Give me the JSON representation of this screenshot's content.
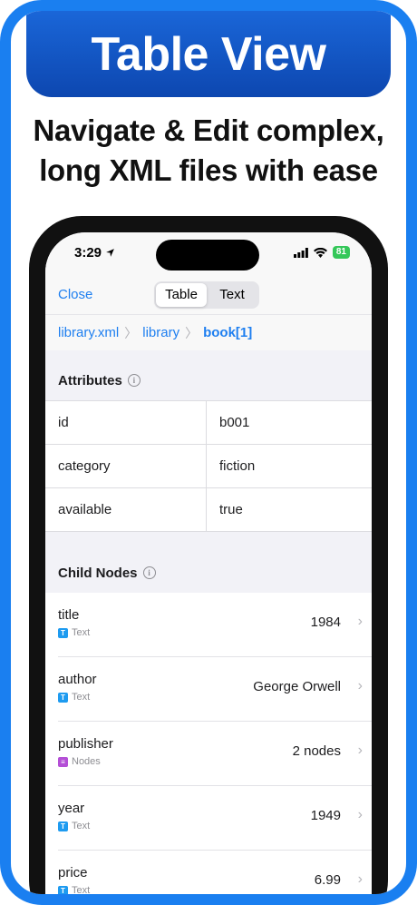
{
  "promo": {
    "banner_title": "Table View",
    "headline_line1": "Navigate & Edit complex,",
    "headline_line2": "long XML files with ease",
    "brand_color": "#1a7ff0"
  },
  "status_bar": {
    "time": "3:29",
    "battery": "81"
  },
  "navbar": {
    "close_label": "Close",
    "tabs": [
      {
        "label": "Table",
        "selected": true
      },
      {
        "label": "Text",
        "selected": false
      }
    ]
  },
  "breadcrumb": {
    "items": [
      "library.xml",
      "library",
      "book[1]"
    ]
  },
  "attributes": {
    "header": "Attributes",
    "rows": [
      {
        "key": "id",
        "value": "b001"
      },
      {
        "key": "category",
        "value": "fiction"
      },
      {
        "key": "available",
        "value": "true"
      }
    ]
  },
  "child_nodes": {
    "header": "Child Nodes",
    "items": [
      {
        "name": "title",
        "type": "Text",
        "type_icon": "T",
        "type_color": "#1e9bf0",
        "value": "1984"
      },
      {
        "name": "author",
        "type": "Text",
        "type_icon": "T",
        "type_color": "#1e9bf0",
        "value": "George Orwell"
      },
      {
        "name": "publisher",
        "type": "Nodes",
        "type_icon": "list-icon",
        "type_color": "#b44fd6",
        "value": "2 nodes"
      },
      {
        "name": "year",
        "type": "Text",
        "type_icon": "T",
        "type_color": "#1e9bf0",
        "value": "1949"
      },
      {
        "name": "price",
        "type": "Text",
        "type_icon": "T",
        "type_color": "#1e9bf0",
        "value": "6.99"
      }
    ]
  }
}
